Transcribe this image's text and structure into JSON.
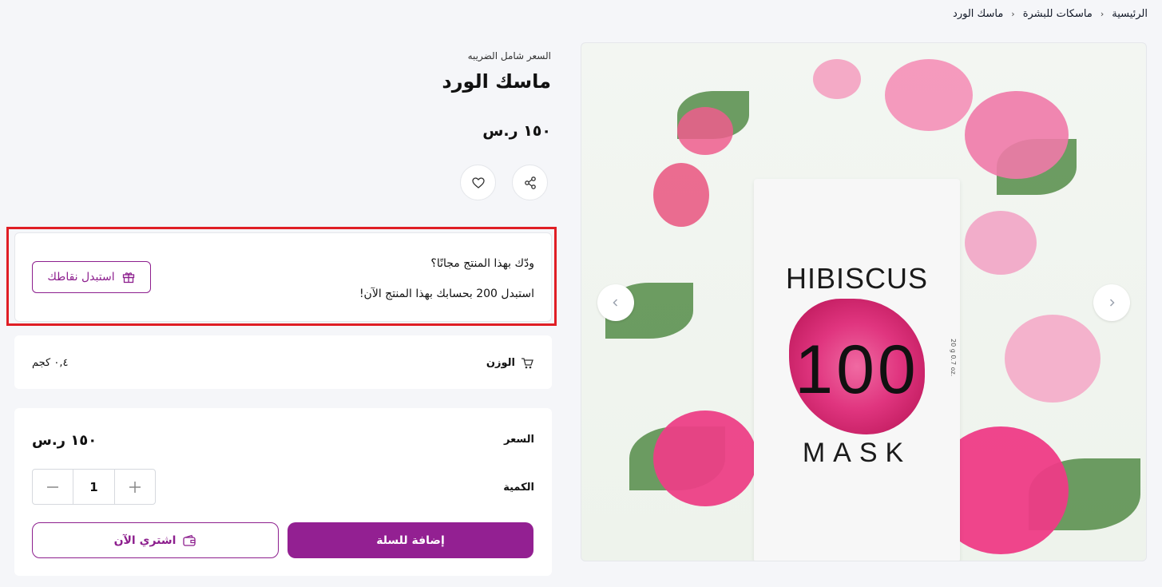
{
  "breadcrumb": {
    "items": [
      "الرئيسية",
      "ماسكات للبشرة",
      "ماسك الورد"
    ],
    "separator": "›"
  },
  "product": {
    "tax_note": "السعر شامل الضريبه",
    "title": "ماسك الورد",
    "price": "١٥٠ ر.س",
    "image": {
      "brand_text": "HIBISCUS",
      "number_text": "100",
      "type_text": "MASK",
      "side_text": "20 g 0.7 oz."
    }
  },
  "actions": {
    "share_icon": "share-icon",
    "wishlist_icon": "heart-icon"
  },
  "redeem": {
    "question": "ودّك بهذا المنتج مجانًا؟",
    "description": "استبدل 200 بحسابك بهذا المنتج الآن!",
    "button_label": "استبدل نقاطك",
    "button_icon": "gift-icon"
  },
  "weight": {
    "label": "الوزن",
    "value": "٠,٤ كجم",
    "icon": "weight-icon"
  },
  "purchase": {
    "price_label": "السعر",
    "price_value": "١٥٠ ر.س",
    "quantity_label": "الكمية",
    "quantity_value": "1",
    "add_to_cart_label": "إضافة للسلة",
    "buy_now_label": "اشتري الآن",
    "buy_now_icon": "wallet-icon"
  },
  "colors": {
    "accent": "#932092",
    "highlight_border": "#e01e25",
    "background": "#f5f6f9"
  }
}
